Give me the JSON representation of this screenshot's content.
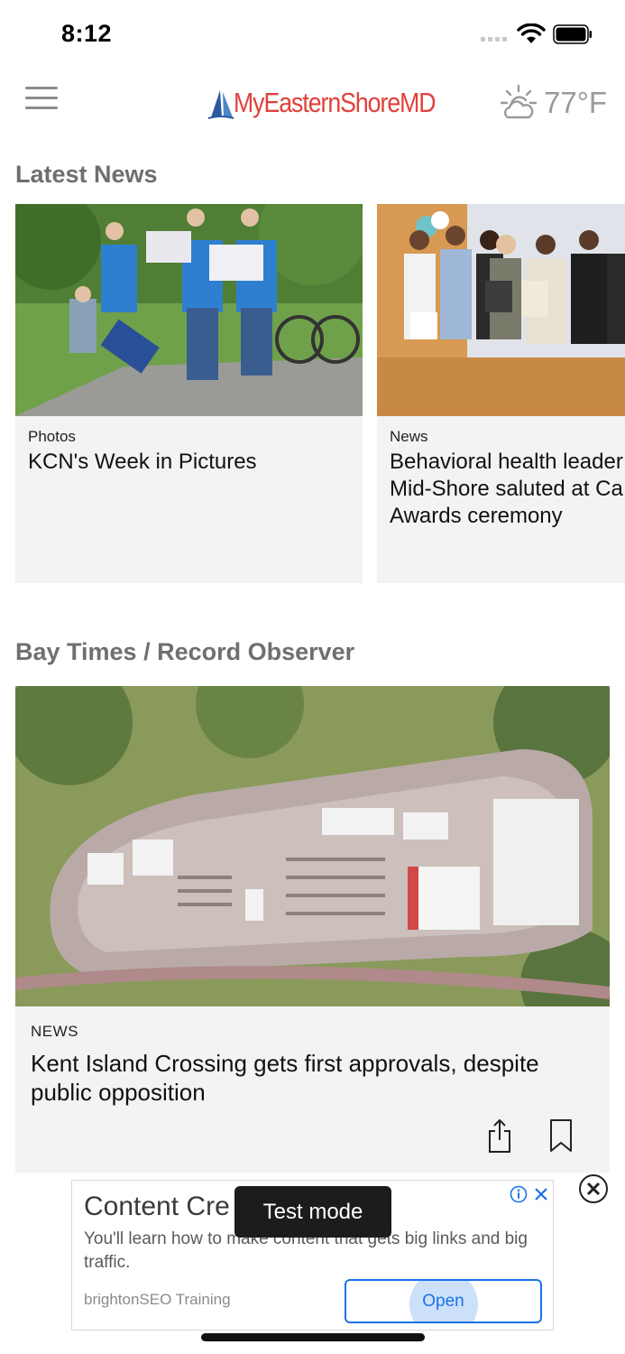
{
  "status_bar": {
    "time": "8:12"
  },
  "header": {
    "logo_text": "MyEasternShoreMD",
    "weather_temp": "77°F",
    "weather_icon": "partly-sunny-icon",
    "menu_icon": "hamburger-menu-icon"
  },
  "latest_news": {
    "title": "Latest News",
    "cards": [
      {
        "category": "Photos",
        "title_lines": [
          "KCN's Week in Pictures"
        ]
      },
      {
        "category": "News",
        "title_lines": [
          "Behavioral health leader",
          "Mid-Shore saluted at Ca",
          "Awards ceremony"
        ]
      }
    ]
  },
  "bay_times": {
    "title": "Bay Times / Record Observer",
    "card": {
      "category": "NEWS",
      "title": "Kent Island Crossing gets first approvals, despite public opposition"
    }
  },
  "ad": {
    "title": "Content Cre                ng",
    "body": "You'll learn how to make content that gets big links and big traffic.",
    "advertiser": "brightonSEO Training",
    "button": "Open"
  },
  "toast": {
    "text": "Test mode"
  },
  "colors": {
    "brand_red": "#e0413b",
    "brand_blue": "#2b5a9e",
    "ad_blue": "#1a73e8"
  }
}
